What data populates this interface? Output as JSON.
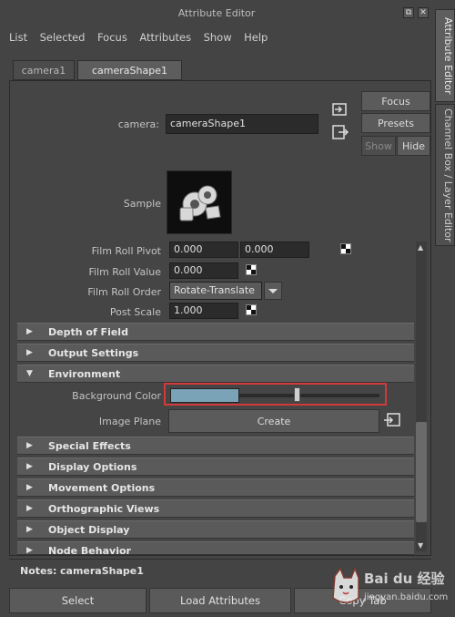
{
  "window": {
    "title": "Attribute Editor"
  },
  "menu": [
    "List",
    "Selected",
    "Focus",
    "Attributes",
    "Show",
    "Help"
  ],
  "tabs": [
    "camera1",
    "cameraShape1"
  ],
  "node": {
    "label": "camera:",
    "value": "cameraShape1"
  },
  "side_buttons": {
    "focus": "Focus",
    "presets": "Presets",
    "show": "Show",
    "hide": "Hide"
  },
  "sample_label": "Sample",
  "attributes": {
    "film_roll_pivot": {
      "label": "Film Roll Pivot",
      "x": "0.000",
      "y": "0.000"
    },
    "film_roll_value": {
      "label": "Film Roll Value",
      "value": "0.000"
    },
    "film_roll_order": {
      "label": "Film Roll Order",
      "value": "Rotate-Translate"
    },
    "post_scale": {
      "label": "Post Scale",
      "value": "1.000"
    }
  },
  "sections": {
    "depth_of_field": "Depth of Field",
    "output_settings": "Output Settings",
    "environment": "Environment",
    "special_effects": "Special Effects",
    "display_options": "Display Options",
    "movement_options": "Movement Options",
    "orthographic_views": "Orthographic Views",
    "object_display": "Object Display",
    "node_behavior": "Node Behavior"
  },
  "environment": {
    "background_color_label": "Background Color",
    "background_color": "#7aa3b7",
    "background_slider_level": 0.56,
    "image_plane_label": "Image Plane",
    "create_button": "Create"
  },
  "notes": {
    "label": "Notes:",
    "value": "cameraShape1"
  },
  "bottom_buttons": {
    "select": "Select",
    "load": "Load Attributes",
    "copy": "Copy Tab"
  },
  "right_tabs": {
    "attribute_editor": "Attribute Editor",
    "channel_box": "Channel Box / Layer Editor"
  },
  "watermark": {
    "brand": "Bai du 经验",
    "url": "jingyan.baidu.com"
  },
  "colors": {
    "highlight": "#d23a3a",
    "panel": "#444444",
    "field": "#2b2b2b"
  }
}
